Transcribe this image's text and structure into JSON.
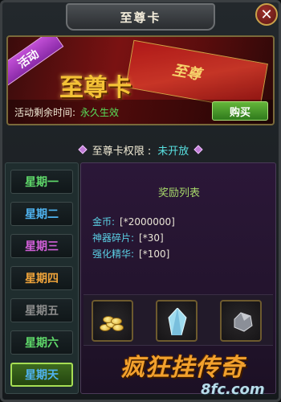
{
  "window": {
    "title": "至尊卡",
    "close_glyph": "✕"
  },
  "banner": {
    "ribbon": "活动",
    "title": "至尊卡",
    "card_text": "至尊",
    "remaining_label": "活动剩余时间:",
    "remaining_value": "永久生效",
    "buy_label": "购买"
  },
  "status": {
    "label": "至尊卡权限 :",
    "value": "未开放"
  },
  "days": [
    {
      "label": "星期一",
      "color": "#5fd86a",
      "selected": false
    },
    {
      "label": "星期二",
      "color": "#4fb3f0",
      "selected": false
    },
    {
      "label": "星期三",
      "color": "#d25fd8",
      "selected": false
    },
    {
      "label": "星期四",
      "color": "#f0a43a",
      "selected": false
    },
    {
      "label": "星期五",
      "color": "#8c8c8c",
      "selected": false
    },
    {
      "label": "星期六",
      "color": "#5fd86a",
      "selected": false
    },
    {
      "label": "星期天",
      "color": "#4fb3f0",
      "selected": true
    }
  ],
  "rewards": {
    "title": "奖励列表",
    "lines": [
      {
        "label": "金币:",
        "value": "[*2000000]"
      },
      {
        "label": "神器碎片:",
        "value": "[*30]"
      },
      {
        "label": "强化精华:",
        "value": "[*100]"
      }
    ],
    "items": [
      {
        "icon": "gold-coins-icon"
      },
      {
        "icon": "crystal-shard-icon"
      },
      {
        "icon": "ore-essence-icon"
      }
    ]
  },
  "watermark": {
    "logo": "疯狂挂传奇",
    "domain": "8fc.com"
  }
}
